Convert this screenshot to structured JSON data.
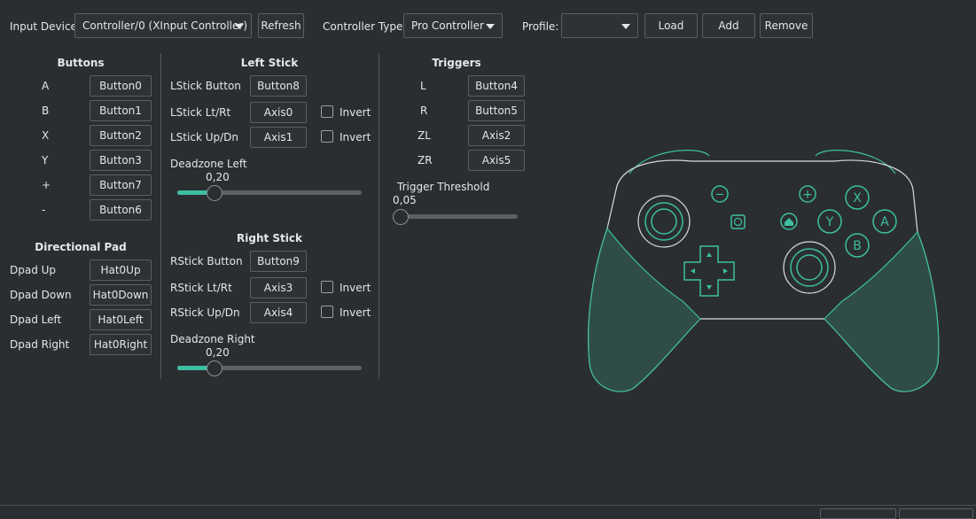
{
  "toolbar": {
    "input_device_label": "Input Device",
    "input_device_value": "Controller/0 (XInput Controller)",
    "refresh_label": "Refresh",
    "controller_type_label": "Controller Type:",
    "controller_type_value": "Pro Controller",
    "profile_label": "Profile:",
    "profile_value": "",
    "load_label": "Load",
    "add_label": "Add",
    "remove_label": "Remove"
  },
  "buttons": {
    "title": "Buttons",
    "rows": [
      {
        "label": "A",
        "value": "Button0"
      },
      {
        "label": "B",
        "value": "Button1"
      },
      {
        "label": "X",
        "value": "Button2"
      },
      {
        "label": "Y",
        "value": "Button3"
      },
      {
        "label": "+",
        "value": "Button7"
      },
      {
        "label": "-",
        "value": "Button6"
      }
    ]
  },
  "dpad": {
    "title": "Directional Pad",
    "rows": [
      {
        "label": "Dpad Up",
        "value": "Hat0Up"
      },
      {
        "label": "Dpad Down",
        "value": "Hat0Down"
      },
      {
        "label": "Dpad Left",
        "value": "Hat0Left"
      },
      {
        "label": "Dpad Right",
        "value": "Hat0Right"
      }
    ]
  },
  "left_stick": {
    "title": "Left Stick",
    "button_label": "LStick Button",
    "button_value": "Button8",
    "lr_label": "LStick Lt/Rt",
    "lr_value": "Axis0",
    "ud_label": "LStick Up/Dn",
    "ud_value": "Axis1",
    "invert_label": "Invert",
    "deadzone_label": "Deadzone Left",
    "deadzone_value": "0,20",
    "deadzone_fraction": 0.2
  },
  "right_stick": {
    "title": "Right Stick",
    "button_label": "RStick Button",
    "button_value": "Button9",
    "lr_label": "RStick Lt/Rt",
    "lr_value": "Axis3",
    "ud_label": "RStick Up/Dn",
    "ud_value": "Axis4",
    "invert_label": "Invert",
    "deadzone_label": "Deadzone Right",
    "deadzone_value": "0,20",
    "deadzone_fraction": 0.2
  },
  "triggers": {
    "title": "Triggers",
    "rows": [
      {
        "label": "L",
        "value": "Button4"
      },
      {
        "label": "R",
        "value": "Button5"
      },
      {
        "label": "ZL",
        "value": "Axis2"
      },
      {
        "label": "ZR",
        "value": "Axis5"
      }
    ],
    "threshold_label": "Trigger Threshold",
    "threshold_value": "0,05",
    "threshold_fraction": 0.05
  },
  "controller_image": {
    "face_buttons": [
      "X",
      "Y",
      "A",
      "B"
    ],
    "minus_symbol": "−",
    "plus_symbol": "+",
    "accent": "#3cbfa0",
    "outline": "#d8dcdf"
  }
}
